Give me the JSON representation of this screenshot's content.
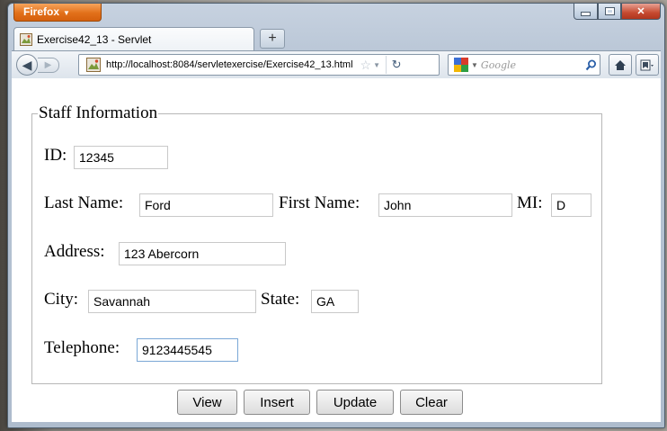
{
  "browser": {
    "menu_label": "Firefox",
    "tab_title": "Exercise42_13 - Servlet",
    "url": "http://localhost:8084/servletexercise/Exercise42_13.html",
    "search_placeholder": "Google"
  },
  "form": {
    "legend": "Staff Information",
    "id_label": "ID:",
    "id_value": "12345",
    "last_name_label": "Last Name:",
    "last_name_value": "Ford",
    "first_name_label": "First Name:",
    "first_name_value": "John",
    "mi_label": "MI:",
    "mi_value": "D",
    "address_label": "Address:",
    "address_value": "123 Abercorn",
    "city_label": "City:",
    "city_value": "Savannah",
    "state_label": "State:",
    "state_value": "GA",
    "telephone_label": "Telephone:",
    "telephone_value": "9123445545"
  },
  "buttons": {
    "view": "View",
    "insert": "Insert",
    "update": "Update",
    "clear": "Clear"
  },
  "colors": {
    "firefox_orange": "#e2701a",
    "window_chrome": "#b9c6d6",
    "close_red": "#c64a30",
    "focus_border": "#7aa7d6"
  }
}
